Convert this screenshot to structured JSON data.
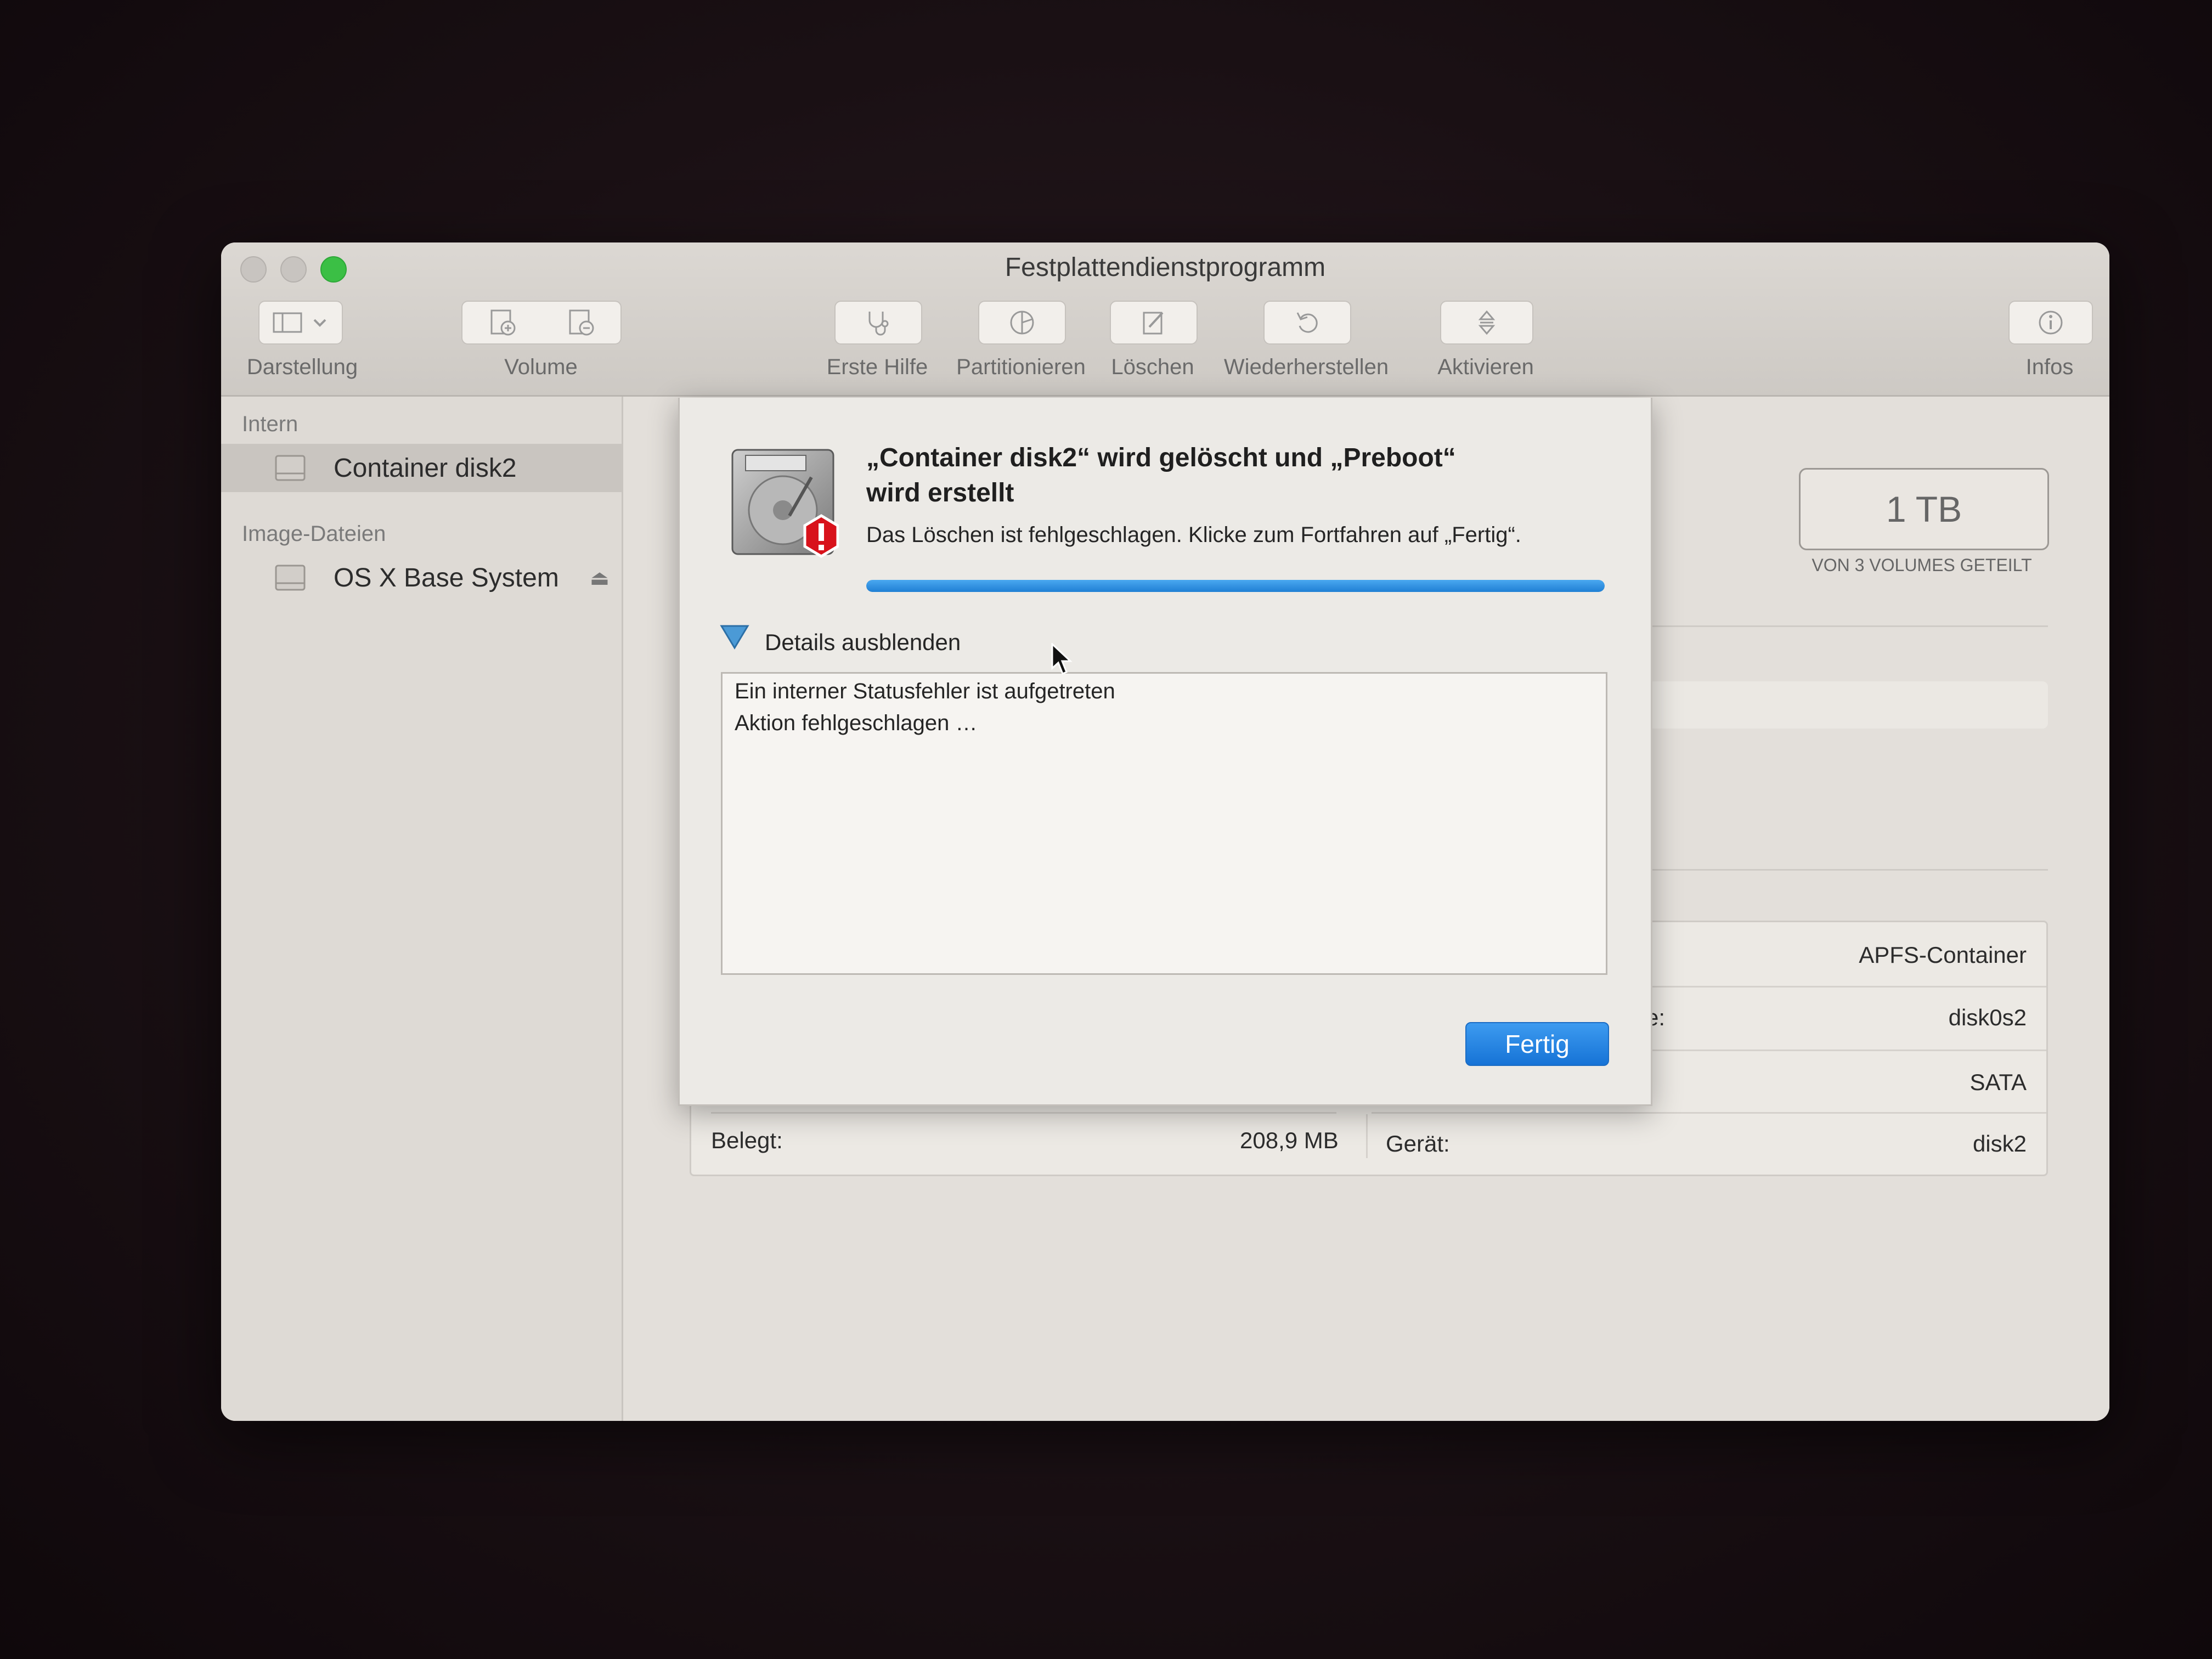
{
  "window": {
    "title": "Festplattendienstprogramm"
  },
  "toolbar": {
    "darstellung": "Darstellung",
    "volume": "Volume",
    "erste_hilfe": "Erste Hilfe",
    "partitionieren": "Partitionieren",
    "loeschen": "Löschen",
    "wiederherstellen": "Wiederherstellen",
    "aktivieren": "Aktivieren",
    "infos": "Infos"
  },
  "sidebar": {
    "section_intern": "Intern",
    "section_images": "Image-Dateien",
    "items": [
      {
        "label": "Container disk2",
        "selected": true
      },
      {
        "label": "OS X Base System",
        "selected": false
      }
    ],
    "eject_glyph": "⏏"
  },
  "main": {
    "capacity": "1 TB",
    "capacity_sub": "VON 3 VOLUMES GETEILT",
    "info": {
      "type_value": "APFS-Container",
      "partial_label": "e:",
      "device_value_top": "disk0s2",
      "connection_value": "SATA",
      "belegt_label": "Belegt:",
      "belegt_value": "208,9 MB",
      "geraet_label": "Gerät:",
      "geraet_value": "disk2"
    }
  },
  "dialog": {
    "title_line1": "„Container disk2“ wird gelöscht und „Preboot“",
    "title_line2": "wird erstellt",
    "message": "Das Löschen ist fehlgeschlagen. Klicke zum Fortfahren auf „Fertig“.",
    "progress": 1.0,
    "details_toggle": "Details ausblenden",
    "log": [
      "Ein interner Statusfehler ist aufgetreten",
      "Aktion fehlgeschlagen …"
    ],
    "done_button": "Fertig",
    "colors": {
      "accent": "#1f7fd4",
      "error": "#d8121b"
    }
  }
}
